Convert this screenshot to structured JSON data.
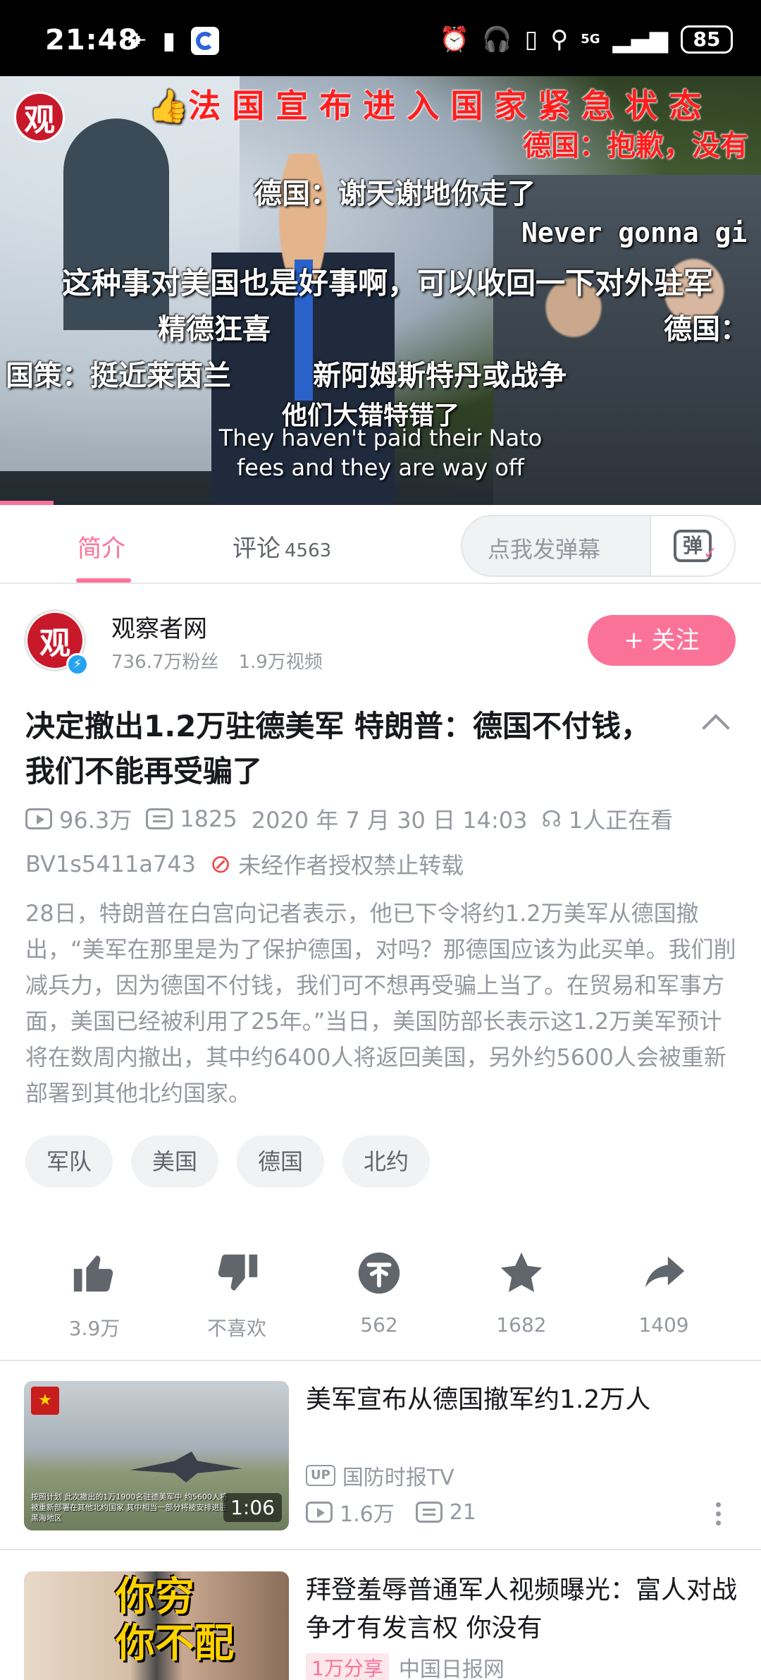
{
  "status_bar": {
    "time": "21:48",
    "network": "5G",
    "battery": "85",
    "icons": [
      "airplane-icon",
      "battery-saver-icon",
      "app-icon",
      "alarm-icon",
      "headphones-icon",
      "vibrate-icon",
      "location-icon",
      "signal-icon"
    ]
  },
  "video": {
    "logo": "观",
    "danmaku": [
      {
        "text": "法 国 宣 布 进 入 国 家 紧 急 状 态",
        "style": "red"
      },
      {
        "text": "德国：抱歉，没有",
        "style": "red"
      },
      {
        "text": "德国：谢天谢地你走了",
        "style": "white"
      },
      {
        "text": "Never gonna gi",
        "style": "mono"
      },
      {
        "text": "这种事对美国也是好事啊，可以收回一下对外驻军",
        "style": "white"
      },
      {
        "text": "精德狂喜",
        "style": "white"
      },
      {
        "text": "德国：",
        "style": "white"
      },
      {
        "text": "国策：挺近莱茵兰",
        "style": "white"
      },
      {
        "text": "新阿姆斯特丹或战争",
        "style": "white"
      },
      {
        "text": "他们大错特错了",
        "style": "white"
      }
    ],
    "subtitle": [
      "They haven't paid their Nato",
      "fees and they are way off"
    ],
    "progress": 0.07
  },
  "tabs": {
    "intro": "简介",
    "comments": "评论",
    "comments_count": "4563",
    "danmu_placeholder": "点我发弹幕",
    "danmu_icon": "弹"
  },
  "uploader": {
    "avatar_text": "观",
    "name": "观察者网",
    "followers": "736.7万粉丝",
    "videos": "1.9万视频",
    "follow_label": "+ 关注"
  },
  "video_info": {
    "title": "决定撤出1.2万驻德美军 特朗普：德国不付钱，我们不能再受骗了",
    "views": "96.3万",
    "danmaku_count": "1825",
    "date": "2020 年 7 月 30 日 14:03",
    "watching": "1人正在看",
    "bvid": "BV1s5411a743",
    "repost_notice": "未经作者授权禁止转载",
    "description": "28日，特朗普在白宫向记者表示，他已下令将约1.2万美军从德国撤出，“美军在那里是为了保护德国，对吗？那德国应该为此买单。我们削减兵力，因为德国不付钱，我们可不想再受骗上当了。在贸易和军事方面，美国已经被利用了25年。”当日，美国防部长表示这1.2万美军预计将在数周内撤出，其中约6400人将返回美国，另外约5600人会被重新部署到其他北约国家。",
    "tags": [
      "军队",
      "美国",
      "德国",
      "北约"
    ]
  },
  "actions": {
    "like": "3.9万",
    "dislike": "不喜欢",
    "coin": "562",
    "favorite": "1682",
    "share": "1409"
  },
  "recommendations": [
    {
      "title": "美军宣布从德国撤军约1.2万人",
      "up_badge": "UP",
      "uploader": "国防时报TV",
      "views": "1.6万",
      "danmaku": "21",
      "duration": "1:06",
      "thumb_badge": "★",
      "thumb_caption": "按照计划 此次撤出的1万1900名驻德美军中 约5600人将被重新部署在其他北约国家 其中相当一部分将被安排进驻黑海地区"
    },
    {
      "title": "拜登羞辱普通军人视频曝光：富人对战争才有发言权 你没有",
      "share_badge": "1万分享",
      "uploader": "中国日报网",
      "thumb_text": [
        "你穷",
        "你不配"
      ]
    }
  ]
}
